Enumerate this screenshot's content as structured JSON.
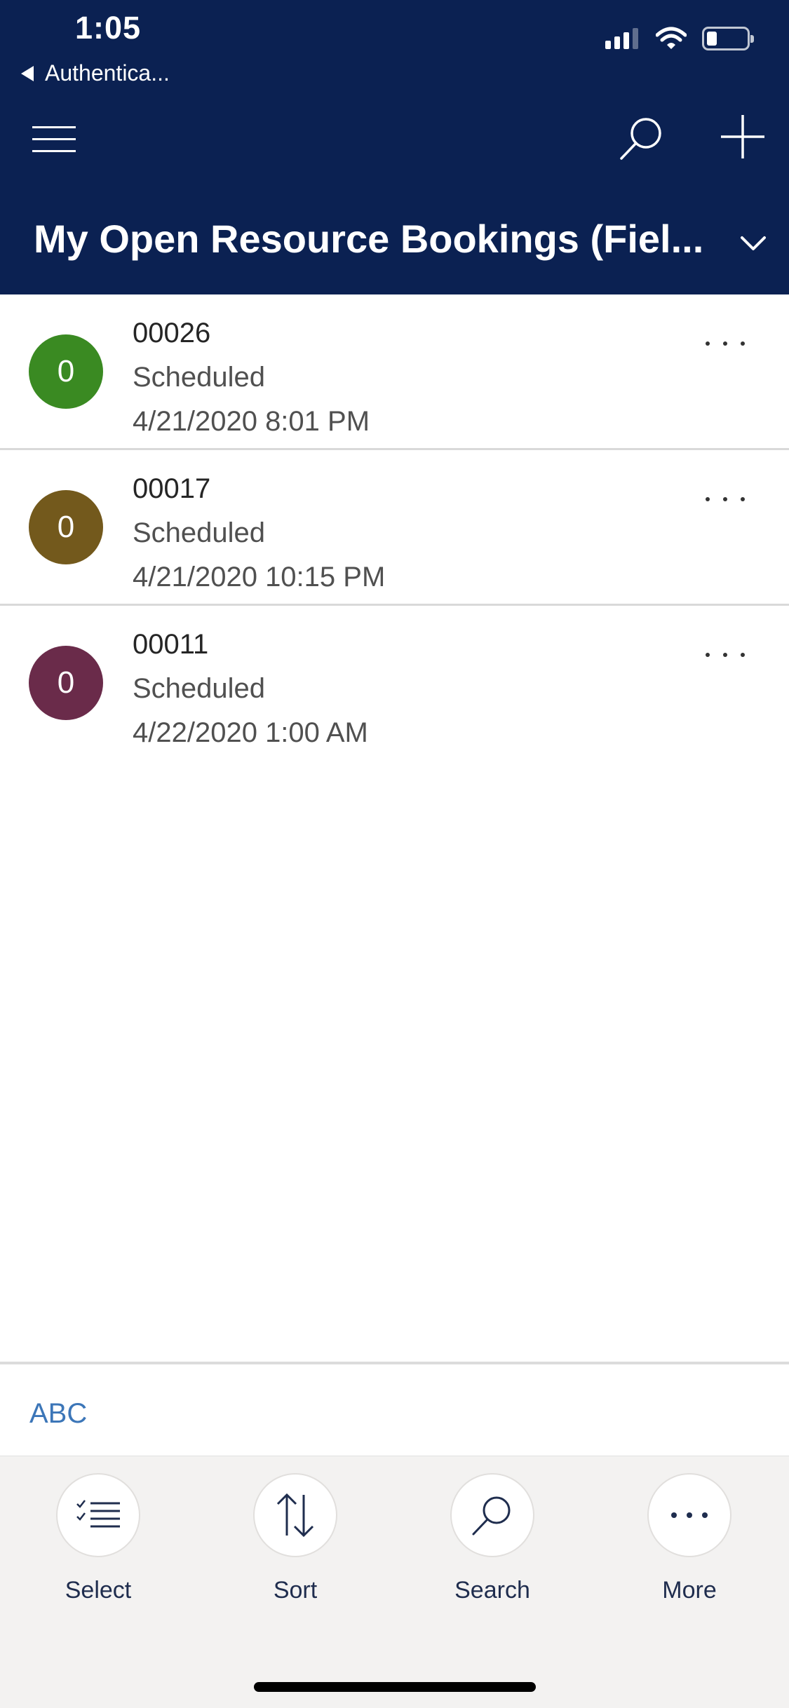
{
  "status_bar": {
    "time": "1:05",
    "back_label": "Authentica..."
  },
  "header": {
    "menu_icon": "hamburger-icon",
    "search_icon": "search-icon",
    "add_icon": "plus-icon",
    "view_title": "My Open Resource Bookings (Fiel...",
    "view_selector_icon": "chevron-down-icon",
    "background_color": "#0b2152"
  },
  "records": [
    {
      "avatar_letter": "0",
      "avatar_color": "#3a8a22",
      "number": "00026",
      "status": "Scheduled",
      "datetime": "4/21/2020 8:01 PM"
    },
    {
      "avatar_letter": "0",
      "avatar_color": "#73591c",
      "number": "00017",
      "status": "Scheduled",
      "datetime": "4/21/2020 10:15 PM"
    },
    {
      "avatar_letter": "0",
      "avatar_color": "#6a2b4a",
      "number": "00011",
      "status": "Scheduled",
      "datetime": "4/22/2020 1:00 AM"
    }
  ],
  "alpha_filter": {
    "label": "ABC",
    "color": "#3c76b8"
  },
  "command_bar": {
    "items": [
      {
        "label": "Select",
        "icon": "select-list-icon"
      },
      {
        "label": "Sort",
        "icon": "sort-arrows-icon"
      },
      {
        "label": "Search",
        "icon": "search-icon"
      },
      {
        "label": "More",
        "icon": "more-dots-icon"
      }
    ]
  }
}
